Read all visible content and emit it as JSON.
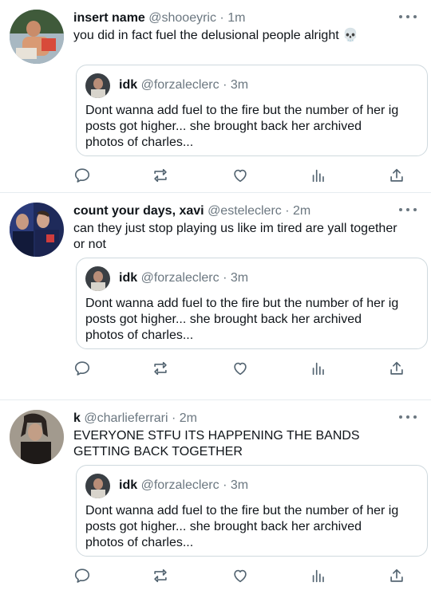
{
  "tweets": [
    {
      "name": "insert name",
      "handle": "@shooeyric",
      "time": "1m",
      "text": "you did in fact fuel the delusional people alright 💀",
      "avatar_icon": "user-photo-avatar",
      "quote": {
        "name": "idk",
        "handle": "@forzaleclerc",
        "time": "3m",
        "text": "Dont wanna add fuel to the fire but the number of her ig posts got higher... she brought back her archived photos of charles..."
      }
    },
    {
      "name": "count your days, xavi",
      "handle": "@esteleclerc",
      "time": "2m",
      "text": "can they just stop playing us like im tired are yall together or not",
      "avatar_icon": "user-photo-avatar",
      "quote": {
        "name": "idk",
        "handle": "@forzaleclerc",
        "time": "3m",
        "text": "Dont wanna add fuel to the fire but the number of her ig posts got higher... she brought back her archived photos of charles..."
      }
    },
    {
      "name": "k",
      "handle": "@charlieferrari",
      "time": "2m",
      "text": "EVERYONE STFU ITS HAPPENING THE BANDS GETTING BACK TOGETHER",
      "avatar_icon": "user-photo-avatar",
      "quote": {
        "name": "idk",
        "handle": "@forzaleclerc",
        "time": "3m",
        "text": "Dont wanna add fuel to the fire but the number of her ig posts got higher... she brought back her archived photos of charles..."
      }
    }
  ],
  "separator": " · ",
  "actions": [
    "reply-icon",
    "retweet-icon",
    "like-icon",
    "views-icon",
    "share-icon"
  ],
  "colors": {
    "text": "#0f1419",
    "secondary": "#6b7780",
    "border": "#cfd9de",
    "divider": "#e6ecf0"
  }
}
